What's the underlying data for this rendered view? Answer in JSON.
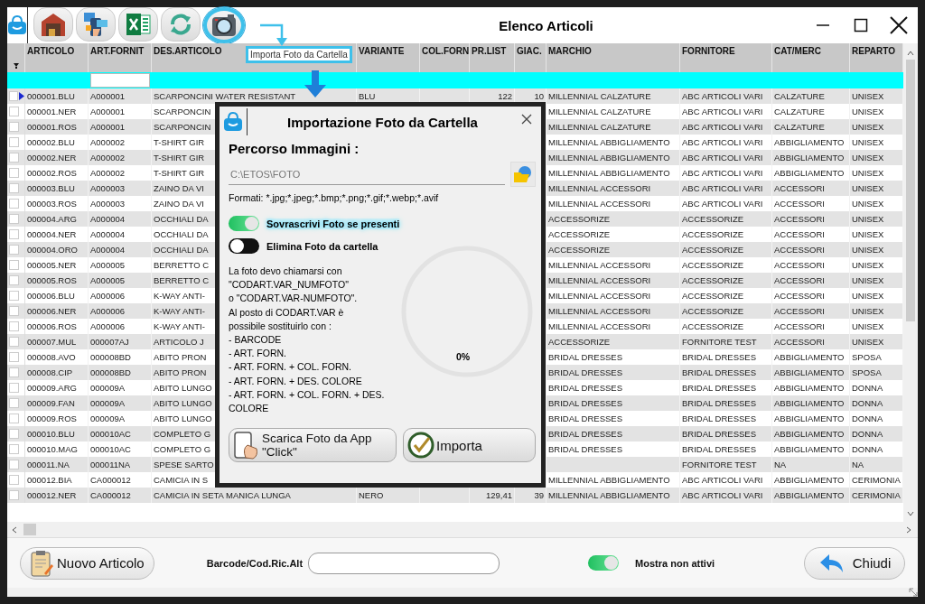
{
  "window": {
    "title": "Elenco Articoli"
  },
  "toolbar": [
    {
      "kind": "warehouse",
      "selected": false
    },
    {
      "kind": "media",
      "selected": false
    },
    {
      "kind": "excel",
      "selected": false
    },
    {
      "kind": "refresh",
      "selected": false
    },
    {
      "kind": "camera",
      "selected": true
    }
  ],
  "tooltip": {
    "text": "Importa Foto da Cartella"
  },
  "table": {
    "columns": [
      "ARTICOLO",
      "ART.FORNIT",
      "DES.ARTICOLO",
      "VARIANTE",
      "COL.FORN",
      "PR.LIST",
      "GIAC.",
      "MARCHIO",
      "FORNITORE",
      "CAT/MERC",
      "REPARTO"
    ],
    "rows": [
      {
        "selected": true,
        "checked": false,
        "cells": [
          "000001.BLU",
          "A000001",
          "SCARPONCINI WATER RESISTANT",
          "BLU",
          null,
          "122",
          "10",
          "MILLENNIAL CALZATURE",
          "ABC ARTICOLI VARI",
          "CALZATURE",
          "UNISEX"
        ]
      },
      {
        "selected": false,
        "checked": false,
        "cells": [
          "000001.NER",
          "A000001",
          "SCARPONCIN",
          null,
          null,
          null,
          null,
          "MILLENNIAL CALZATURE",
          "ABC ARTICOLI VARI",
          "CALZATURE",
          "UNISEX"
        ]
      },
      {
        "selected": false,
        "checked": false,
        "cells": [
          "000001.ROS",
          "A000001",
          "SCARPONCIN",
          null,
          null,
          null,
          null,
          "MILLENNIAL CALZATURE",
          "ABC ARTICOLI VARI",
          "CALZATURE",
          "UNISEX"
        ]
      },
      {
        "selected": false,
        "checked": false,
        "cells": [
          "000002.BLU",
          "A000002",
          "T-SHIRT GIR",
          null,
          null,
          null,
          null,
          "MILLENNIAL ABBIGLIAMENTO",
          "ABC ARTICOLI VARI",
          "ABBIGLIAMENTO",
          "UNISEX"
        ]
      },
      {
        "selected": false,
        "checked": false,
        "cells": [
          "000002.NER",
          "A000002",
          "T-SHIRT GIR",
          null,
          null,
          null,
          null,
          "MILLENNIAL ABBIGLIAMENTO",
          "ABC ARTICOLI VARI",
          "ABBIGLIAMENTO",
          "UNISEX"
        ]
      },
      {
        "selected": false,
        "checked": false,
        "cells": [
          "000002.ROS",
          "A000002",
          "T-SHIRT GIR",
          null,
          null,
          null,
          null,
          "MILLENNIAL ABBIGLIAMENTO",
          "ABC ARTICOLI VARI",
          "ABBIGLIAMENTO",
          "UNISEX"
        ]
      },
      {
        "selected": false,
        "checked": false,
        "cells": [
          "000003.BLU",
          "A000003",
          "ZAINO DA VI",
          null,
          null,
          null,
          null,
          "MILLENNIAL ACCESSORI",
          "ABC ARTICOLI VARI",
          "ACCESSORI",
          "UNISEX"
        ]
      },
      {
        "selected": false,
        "checked": false,
        "cells": [
          "000003.ROS",
          "A000003",
          "ZAINO DA VI",
          null,
          null,
          null,
          null,
          "MILLENNIAL ACCESSORI",
          "ABC ARTICOLI VARI",
          "ACCESSORI",
          "UNISEX"
        ]
      },
      {
        "selected": false,
        "checked": false,
        "cells": [
          "000004.ARG",
          "A000004",
          "OCCHIALI DA",
          null,
          null,
          null,
          null,
          "ACCESSORIZE",
          "ACCESSORIZE",
          "ACCESSORI",
          "UNISEX"
        ]
      },
      {
        "selected": false,
        "checked": false,
        "cells": [
          "000004.NER",
          "A000004",
          "OCCHIALI DA",
          null,
          null,
          null,
          null,
          "ACCESSORIZE",
          "ACCESSORIZE",
          "ACCESSORI",
          "UNISEX"
        ]
      },
      {
        "selected": false,
        "checked": false,
        "cells": [
          "000004.ORO",
          "A000004",
          "OCCHIALI DA",
          null,
          null,
          null,
          null,
          "ACCESSORIZE",
          "ACCESSORIZE",
          "ACCESSORI",
          "UNISEX"
        ]
      },
      {
        "selected": false,
        "checked": false,
        "cells": [
          "000005.NER",
          "A000005",
          "BERRETTO C",
          null,
          null,
          null,
          null,
          "MILLENNIAL ACCESSORI",
          "ACCESSORIZE",
          "ACCESSORI",
          "UNISEX"
        ]
      },
      {
        "selected": false,
        "checked": false,
        "cells": [
          "000005.ROS",
          "A000005",
          "BERRETTO C",
          null,
          null,
          null,
          null,
          "MILLENNIAL ACCESSORI",
          "ACCESSORIZE",
          "ACCESSORI",
          "UNISEX"
        ]
      },
      {
        "selected": false,
        "checked": false,
        "cells": [
          "000006.BLU",
          "A000006",
          "K-WAY ANTI-",
          null,
          null,
          null,
          null,
          "MILLENNIAL ACCESSORI",
          "ACCESSORIZE",
          "ACCESSORI",
          "UNISEX"
        ]
      },
      {
        "selected": false,
        "checked": false,
        "cells": [
          "000006.NER",
          "A000006",
          "K-WAY ANTI-",
          null,
          null,
          null,
          null,
          "MILLENNIAL ACCESSORI",
          "ACCESSORIZE",
          "ACCESSORI",
          "UNISEX"
        ]
      },
      {
        "selected": false,
        "checked": false,
        "cells": [
          "000006.ROS",
          "A000006",
          "K-WAY ANTI-",
          null,
          null,
          null,
          null,
          "MILLENNIAL ACCESSORI",
          "ACCESSORIZE",
          "ACCESSORI",
          "UNISEX"
        ]
      },
      {
        "selected": false,
        "checked": false,
        "cells": [
          "000007.MUL",
          "000007AJ",
          "ARTICOLO J",
          null,
          null,
          null,
          null,
          "ACCESSORIZE",
          "FORNITORE TEST",
          "ACCESSORI",
          "UNISEX"
        ]
      },
      {
        "selected": false,
        "checked": false,
        "cells": [
          "000008.AVO",
          "000008BD",
          "ABITO PRON",
          null,
          null,
          null,
          null,
          "BRIDAL DRESSES",
          "BRIDAL DRESSES",
          "ABBIGLIAMENTO",
          "SPOSA"
        ]
      },
      {
        "selected": false,
        "checked": false,
        "cells": [
          "000008.CIP",
          "000008BD",
          "ABITO PRON",
          null,
          null,
          null,
          null,
          "BRIDAL DRESSES",
          "BRIDAL DRESSES",
          "ABBIGLIAMENTO",
          "SPOSA"
        ]
      },
      {
        "selected": false,
        "checked": false,
        "cells": [
          "000009.ARG",
          "000009A",
          "ABITO LUNGO",
          null,
          null,
          null,
          null,
          "BRIDAL DRESSES",
          "BRIDAL DRESSES",
          "ABBIGLIAMENTO",
          "DONNA"
        ]
      },
      {
        "selected": false,
        "checked": false,
        "cells": [
          "000009.FAN",
          "000009A",
          "ABITO LUNGO",
          null,
          null,
          null,
          null,
          "BRIDAL DRESSES",
          "BRIDAL DRESSES",
          "ABBIGLIAMENTO",
          "DONNA"
        ]
      },
      {
        "selected": false,
        "checked": false,
        "cells": [
          "000009.ROS",
          "000009A",
          "ABITO LUNGO",
          null,
          null,
          null,
          null,
          "BRIDAL DRESSES",
          "BRIDAL DRESSES",
          "ABBIGLIAMENTO",
          "DONNA"
        ]
      },
      {
        "selected": false,
        "checked": false,
        "cells": [
          "000010.BLU",
          "000010AC",
          "COMPLETO G",
          null,
          null,
          null,
          null,
          "BRIDAL DRESSES",
          "BRIDAL DRESSES",
          "ABBIGLIAMENTO",
          "DONNA"
        ]
      },
      {
        "selected": false,
        "checked": false,
        "cells": [
          "000010.MAG",
          "000010AC",
          "COMPLETO G",
          null,
          null,
          null,
          null,
          "BRIDAL DRESSES",
          "BRIDAL DRESSES",
          "ABBIGLIAMENTO",
          "DONNA"
        ]
      },
      {
        "selected": false,
        "checked": false,
        "cells": [
          "000011.NA",
          "000011NA",
          "SPESE SARTO",
          null,
          null,
          null,
          null,
          null,
          "FORNITORE TEST",
          "NA",
          "NA"
        ]
      },
      {
        "selected": false,
        "checked": false,
        "cells": [
          "000012.BIA",
          "CA000012",
          "CAMICIA IN S",
          null,
          null,
          null,
          null,
          "MILLENNIAL ABBIGLIAMENTO",
          "ABC ARTICOLI VARI",
          "ABBIGLIAMENTO",
          "CERIMONIA"
        ]
      },
      {
        "selected": false,
        "checked": false,
        "cells": [
          "000012.NER",
          "CA000012",
          "CAMICIA IN SETA MANICA LUNGA",
          "NERO",
          null,
          "129,41",
          "39",
          "MILLENNIAL ABBIGLIAMENTO",
          "ABC ARTICOLI VARI",
          "ABBIGLIAMENTO",
          "CERIMONIA"
        ]
      }
    ]
  },
  "dialog": {
    "title": "Importazione Foto da Cartella",
    "path_label": "Percorso Immagini :",
    "path_value": "C:\\ETOS\\FOTO",
    "formats": "Formati: *.jpg;*.jpeg;*.bmp;*.png;*.gif;*.webp;*.avif",
    "options": [
      {
        "label": "Sovrascrivi Foto se presenti",
        "on": true,
        "highlighted": true
      },
      {
        "label": "Elimina Foto da cartella",
        "on": false,
        "highlighted": false
      }
    ],
    "note": "La foto devo chiamarsi con\n\"CODART.VAR_NUMFOTO\"\no \"CODART.VAR-NUMFOTO\".\nAl posto di CODART.VAR è\npossibile sostituirlo con :\n- BARCODE\n- ART. FORN.\n- ART. FORN. + COL. FORN.\n- ART. FORN. + DES. COLORE\n- ART. FORN. + COL. FORN. + DES.\nCOLORE",
    "progress": {
      "level": 0,
      "reading": "0%"
    },
    "buttons": [
      {
        "kind": "download",
        "label": "Scarica Foto da App\n\"Click\""
      },
      {
        "kind": "import",
        "label": "Importa"
      }
    ]
  },
  "footer": {
    "new_button": "Nuovo Articolo",
    "barcode_label": "Barcode/Cod.Ric.Alt",
    "show_inactive": {
      "label": "Mostra non attivi",
      "on": true
    },
    "close_button": "Chiudi"
  }
}
